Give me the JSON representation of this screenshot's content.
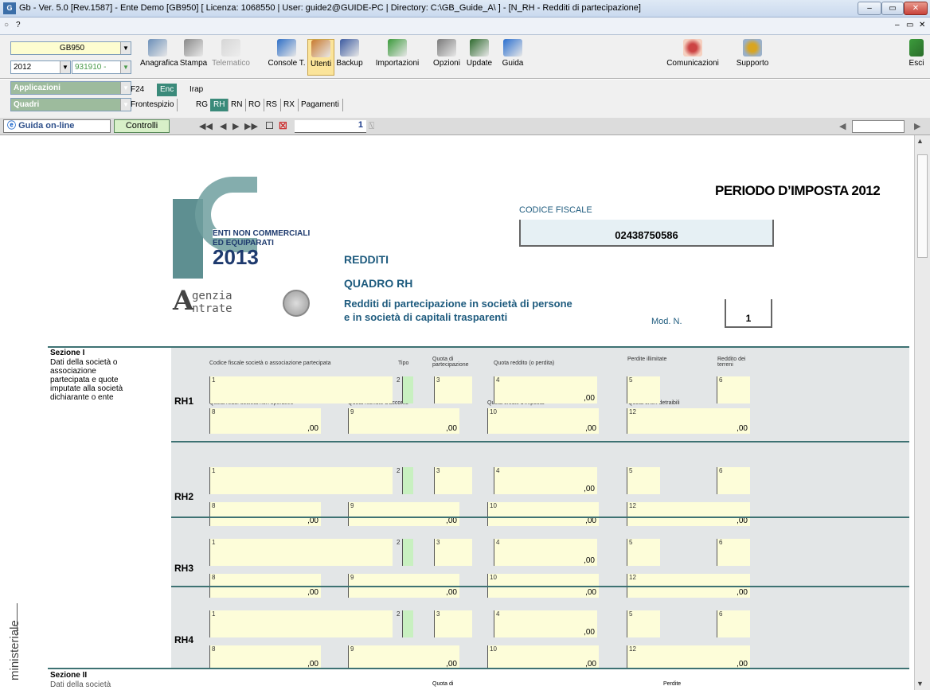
{
  "window": {
    "title": "Gb - Ver. 5.0 [Rev.1587] - Ente Demo [GB950]     [ Licenza: 1068550 | User: guide2@GUIDE-PC | Directory: C:\\GB_Guide_A\\ ] - [N_RH - Redditi di partecipazione]",
    "app_icon": "G",
    "menu": [
      "?"
    ]
  },
  "selectors": {
    "ente": "GB950",
    "year": "2012",
    "code": "931910 -",
    "applicazioni": "Applicazioni",
    "quadri": "Quadri"
  },
  "toolbar": [
    {
      "label": "Anagrafica",
      "icon": "anagrafica-icon",
      "disabled": false
    },
    {
      "label": "Stampa",
      "icon": "printer-icon",
      "disabled": false
    },
    {
      "label": "Telematico",
      "icon": "telematico-icon",
      "disabled": true
    },
    {
      "label": "Console T.",
      "icon": "console-icon",
      "disabled": false
    },
    {
      "label": "Utenti",
      "icon": "users-icon",
      "disabled": false
    },
    {
      "label": "Backup",
      "icon": "backup-icon",
      "disabled": false
    },
    {
      "label": "Importazioni",
      "icon": "import-icon",
      "disabled": false
    },
    {
      "label": "Opzioni",
      "icon": "options-icon",
      "disabled": false
    },
    {
      "label": "Update",
      "icon": "update-icon",
      "disabled": false
    },
    {
      "label": "Guida",
      "icon": "help-icon",
      "disabled": false
    }
  ],
  "toolbar_right": [
    {
      "label": "Comunicazioni",
      "icon": "comunicazioni-icon"
    },
    {
      "label": "Supporto",
      "icon": "supporto-icon"
    }
  ],
  "exit_label": "Esci",
  "modules": [
    "F24",
    "Enc",
    "Irap"
  ],
  "active_module": "Enc",
  "quadri_tabs": [
    "Frontespizio",
    "RG",
    "RH",
    "RN",
    "RO",
    "RS",
    "RX",
    "Pagamenti"
  ],
  "active_quadro": "RH",
  "navbar": {
    "guida": "Guida on-line",
    "controlli": "Controlli",
    "page": "1"
  },
  "form": {
    "periodo": "PERIODO D’IMPOSTA 2012",
    "codice_fiscale_label": "CODICE FISCALE",
    "codice_fiscale": "02438750586",
    "logo_lines": [
      "ENTI NON COMMERCIALI",
      "ED EQUIPARATI",
      "2013"
    ],
    "agenzia": [
      "genzia",
      "ntrate"
    ],
    "redditi": "REDDITI",
    "quadro": "QUADRO RH",
    "subtitle_1": "Redditi di partecipazione in società di persone",
    "subtitle_2": "e in società di capitali trasparenti",
    "mod_label": "Mod. N.",
    "mod_value": "1",
    "sezione1_title": "Sezione I",
    "sezione1_desc": "Dati della società o associazione partecipata e quote imputate alla società dichiarante o ente",
    "headers": {
      "cf": "Codice fiscale società o associazione partecipata",
      "tipo": "Tipo",
      "quota_part": "Quota di partecipazione",
      "quota_reddito": "Quota reddito (o perdita)",
      "perdite": "Perdite illimitate",
      "reddito_terreni": "Reddito dei terreni",
      "q8": "Quota redd. società non operative",
      "q9": "Quota ritenute d'acconto",
      "q10": "Quota crediti d'imposta",
      "q12": "Quota oneri detraibili"
    },
    "rows": [
      "RH1",
      "RH2",
      "RH3",
      "RH4"
    ],
    "zero": ",00",
    "side_label": "ministeriale",
    "sezione2_title": "Sezione II",
    "sezione2_cut": "Dati della società",
    "bottom_cut_1": "Quota di",
    "bottom_cut_2": "Perdite"
  }
}
